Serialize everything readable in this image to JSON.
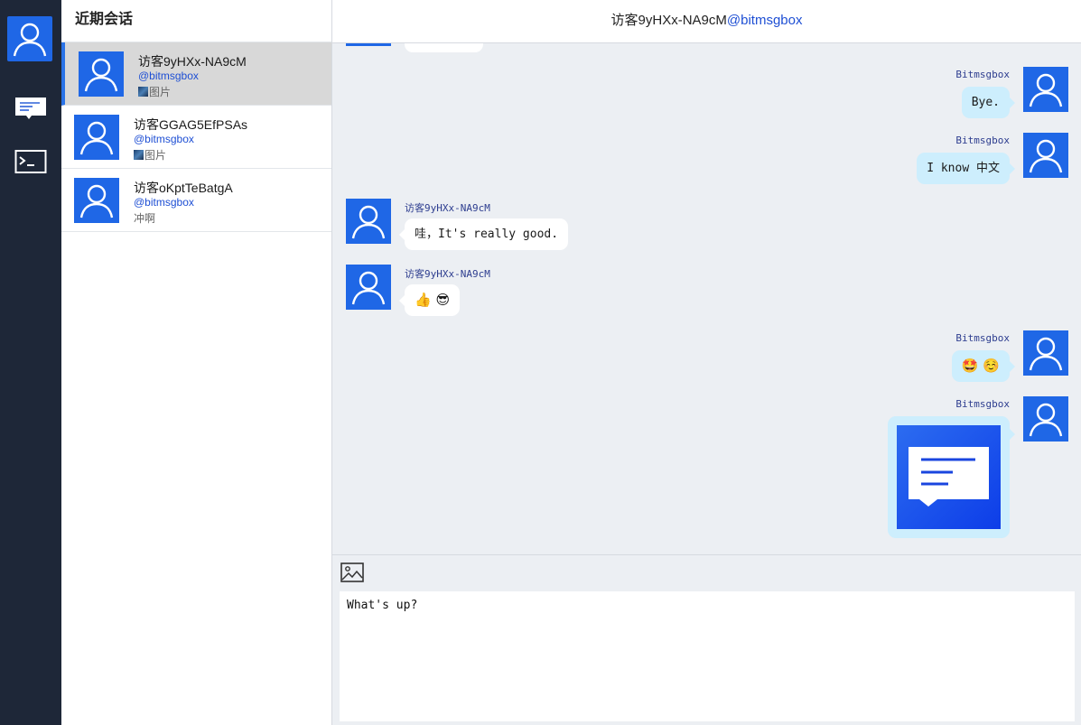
{
  "rail": {
    "profile_icon": "user-icon",
    "items": [
      {
        "icon": "chat-icon"
      },
      {
        "icon": "terminal-icon"
      }
    ]
  },
  "sidebar": {
    "title": "近期会话",
    "conversations": [
      {
        "name": "访客9yHXx-NA9cM",
        "handle": "@bitmsgbox",
        "preview": "图片",
        "preview_icon": "image-thumb-icon",
        "active": true
      },
      {
        "name": "访客GGAG5EfPSAs",
        "handle": "@bitmsgbox",
        "preview": "图片",
        "preview_icon": "image-thumb-icon",
        "active": false
      },
      {
        "name": "访客oKptTeBatgA",
        "handle": "@bitmsgbox",
        "preview": "冲啊",
        "active": false
      }
    ]
  },
  "header": {
    "name": "访客9yHXx-NA9cM",
    "handle": "@bitmsgbox"
  },
  "messages": [
    {
      "direction": "out",
      "sender": "Bitmsgbox",
      "text": "Bye."
    },
    {
      "direction": "out",
      "sender": "Bitmsgbox",
      "text": "I know 中文"
    },
    {
      "direction": "in",
      "sender": "访客9yHXx-NA9cM",
      "text": "哇，It's really good."
    },
    {
      "direction": "in",
      "sender": "访客9yHXx-NA9cM",
      "text": "👍 😎"
    },
    {
      "direction": "out",
      "sender": "Bitmsgbox",
      "text": "🤩 ☺️"
    },
    {
      "direction": "out",
      "sender": "Bitmsgbox",
      "image": true
    }
  ],
  "composer": {
    "image_button_icon": "image-icon",
    "input_value": "What's up?"
  },
  "colors": {
    "rail_bg": "#1e2738",
    "avatar_bg": "#1f67e6",
    "accent": "#1e4fd4",
    "outgoing_bubble": "#cdeefd",
    "incoming_bubble": "#ffffff",
    "active_conversation": "#d8d8d8"
  }
}
